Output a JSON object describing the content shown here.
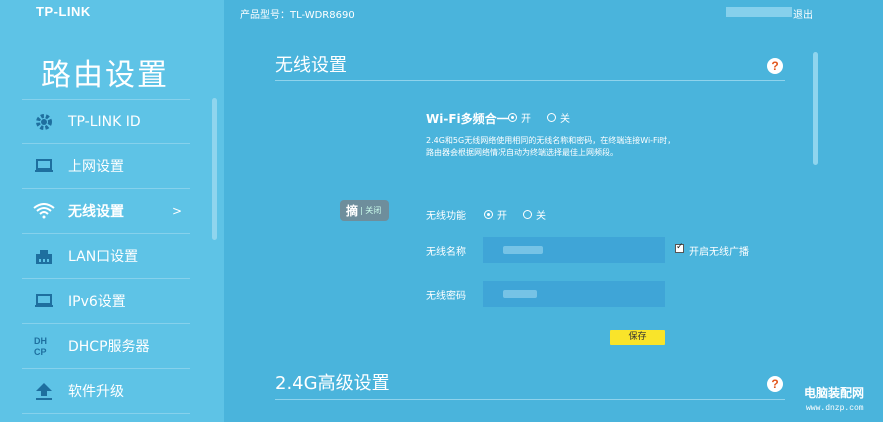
{
  "brand": {
    "logo": "TP-LINK"
  },
  "topbar": {
    "model_label": "产品型号：TL-WDR8690",
    "logout": "退出"
  },
  "sidebar": {
    "title": "路由设置",
    "items": [
      {
        "label": "TP-LINK ID",
        "icon": "gear-icon"
      },
      {
        "label": "上网设置",
        "icon": "laptop-icon"
      },
      {
        "label": "无线设置",
        "icon": "wifi-icon",
        "active": true,
        "arrow": ">"
      },
      {
        "label": "LAN口设置",
        "icon": "lan-port-icon"
      },
      {
        "label": "IPv6设置",
        "icon": "laptop-icon"
      },
      {
        "label": "DHCP服务器",
        "icon": "dhcp-icon"
      },
      {
        "label": "软件升级",
        "icon": "upload-icon"
      }
    ]
  },
  "wireless": {
    "title": "无线设置",
    "multi_band_label": "Wi-Fi多频合一",
    "multi_band_on": "开",
    "multi_band_off": "关",
    "multi_band_selected": "开",
    "description_line1": "2.4G和5G无线网络使用相同的无线名称和密码，在终端连接Wi-Fi时，",
    "description_line2": "路由器会根据网络情况自动为终端选择最佳上网频段。",
    "function_label": "无线功能",
    "function_on": "开",
    "function_off": "关",
    "function_selected": "开",
    "ssid_label": "无线名称",
    "password_label": "无线密码",
    "broadcast_label": "开启无线广播",
    "broadcast_checked": true,
    "save_label": "保存"
  },
  "advanced": {
    "title": "2.4G高级设置"
  },
  "badge": {
    "main": "摘",
    "sep": "| 关闭"
  },
  "help": {
    "symbol": "?"
  },
  "watermark": {
    "name": "电脑装配网",
    "url": "www.dnzp.com"
  },
  "colors": {
    "background": "#4ab4dc",
    "sidebar": "#5ec3e6",
    "help_accent": "#e2571e",
    "save_button": "#f9e42a"
  }
}
